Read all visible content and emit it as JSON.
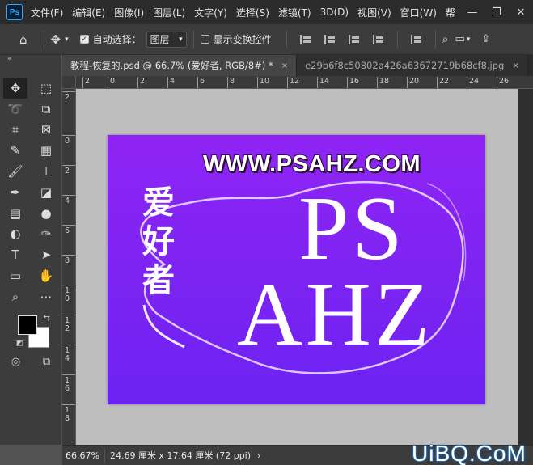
{
  "app": {
    "logo": "Ps"
  },
  "menu": [
    "文件(F)",
    "编辑(E)",
    "图像(I)",
    "图层(L)",
    "文字(Y)",
    "选择(S)",
    "滤镜(T)",
    "3D(D)",
    "视图(V)",
    "窗口(W)",
    "帮"
  ],
  "options": {
    "auto_select_label": "自动选择：",
    "auto_select_value": "图层",
    "show_transform_label": "显示变换控件"
  },
  "toolbar": {
    "collapse": "«"
  },
  "tabs": [
    {
      "label": "教程-恢复的.psd @ 66.7% (爱好者, RGB/8#) *",
      "close": "×"
    },
    {
      "label": "e29b6f8c50802a426a63672719b68cf8.jpg",
      "close": "×"
    }
  ],
  "ruler_h": [
    "2",
    "0",
    "2",
    "4",
    "6",
    "8",
    "10",
    "12",
    "14",
    "16",
    "18",
    "20",
    "22",
    "24",
    "26"
  ],
  "ruler_v": [
    "2",
    "0",
    "2",
    "4",
    "6",
    "8",
    "1\n0",
    "1\n2",
    "1\n4",
    "1\n6",
    "1\n8"
  ],
  "canvas": {
    "url_text": "WWW.PSAHZ.COM",
    "vertical_text": "爱好者",
    "big_line1": "PS",
    "big_line2": "AHZ",
    "bg_top": "#8f24f4",
    "bg_bottom": "#6c23f1"
  },
  "status": {
    "zoom": "66.67%",
    "info": "24.69 厘米 x 17.64 厘米 (72 ppi)",
    "arrow": "›"
  },
  "watermark": "UiBQ.CoM"
}
